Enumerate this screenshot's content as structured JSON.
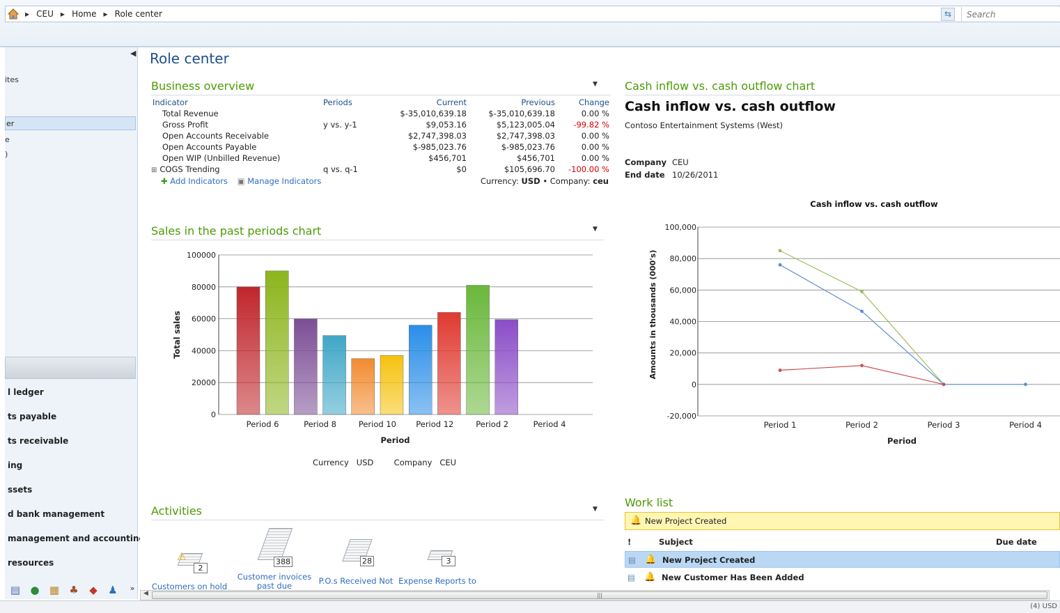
{
  "breadcrumb": [
    "CEU",
    "Home",
    "Role center"
  ],
  "search": {
    "placeholder": "Search"
  },
  "nav": {
    "fragments": [
      "ites",
      "er",
      "e",
      ")"
    ],
    "modules": [
      "l ledger",
      "ts payable",
      "ts receivable",
      "ing",
      "ssets",
      "d bank management",
      "management and accounting",
      "resources"
    ]
  },
  "page": {
    "title": "Role center"
  },
  "business_overview": {
    "title": "Business overview",
    "headers": {
      "indicator": "Indicator",
      "periods": "Periods",
      "current": "Current",
      "previous": "Previous",
      "change": "Change"
    },
    "rows": [
      {
        "indicator": "Total Revenue",
        "periods": "",
        "current": "$-35,010,639.18",
        "previous": "$-35,010,639.18",
        "change": "0.00 %",
        "neg": false
      },
      {
        "indicator": "Gross Profit",
        "periods": "y vs. y-1",
        "current": "$9,053.16",
        "previous": "$5,123,005.04",
        "change": "-99.82 %",
        "neg": true
      },
      {
        "indicator": "Open Accounts Receivable",
        "periods": "",
        "current": "$2,747,398.03",
        "previous": "$2,747,398.03",
        "change": "0.00 %",
        "neg": false
      },
      {
        "indicator": "Open Accounts Payable",
        "periods": "",
        "current": "$-985,023.76",
        "previous": "$-985,023.76",
        "change": "0.00 %",
        "neg": false
      },
      {
        "indicator": "Open WIP (Unbilled Revenue)",
        "periods": "",
        "current": "$456,701",
        "previous": "$456,701",
        "change": "0.00 %",
        "neg": false
      },
      {
        "indicator": "COGS Trending",
        "periods": "q vs. q-1",
        "current": "$0",
        "previous": "$105,696.70",
        "change": "-100.00 %",
        "neg": true
      }
    ],
    "add_label": "Add Indicators",
    "manage_label": "Manage Indicators",
    "currency_label": "Currency:",
    "currency_value": "USD",
    "company_label": "Company:",
    "company_value": "ceu"
  },
  "sales": {
    "title": "Sales in the past periods chart",
    "footer_currency_label": "Currency",
    "footer_currency_value": "USD",
    "footer_company_label": "Company",
    "footer_company_value": "CEU",
    "chart_data": {
      "type": "bar",
      "xlabel": "Period",
      "ylabel": "Total sales",
      "ylim": [
        0,
        100000
      ],
      "yticks": [
        0,
        20000,
        40000,
        60000,
        80000,
        100000
      ],
      "tick_labels": [
        "Period 6",
        "Period 8",
        "Period 10",
        "Period 12",
        "Period 2",
        "Period 4"
      ],
      "grid": true,
      "values": [
        80000,
        90000,
        60000,
        49500,
        35000,
        37000,
        56000,
        64000,
        81000,
        59500
      ],
      "colors": [
        "#c0262c",
        "#8db51d",
        "#7c4e95",
        "#3fa7c7",
        "#f28b30",
        "#f6c20e",
        "#2a8ee8",
        "#e03a30",
        "#6ab83b",
        "#8b4dc7"
      ]
    }
  },
  "cash": {
    "section_title": "Cash inflow vs. cash outflow chart",
    "heading": "Cash inflow vs. cash outflow",
    "subtitle": "Contoso Entertainment Systems (West)",
    "company_label": "Company",
    "company_value": "CEU",
    "enddate_label": "End date",
    "enddate_value": "10/26/2011",
    "chart_data": {
      "type": "line",
      "title": "Cash inflow vs. cash outflow",
      "xlabel": "Period",
      "ylabel": "Amounts in thousands (000's)",
      "categories": [
        "Period 1",
        "Period 2",
        "Period 3",
        "Period 4"
      ],
      "ylim": [
        -20000,
        100000
      ],
      "yticks": [
        -20000,
        0,
        20000,
        40000,
        60000,
        80000,
        100000
      ],
      "ytick_labels": [
        "-20,000",
        "0",
        "20,000",
        "40,000",
        "60,000",
        "80,000",
        "100,000"
      ],
      "grid": true,
      "series": [
        {
          "color": "#9dc05a",
          "values": [
            85000,
            59000,
            0,
            null
          ]
        },
        {
          "color": "#5b8fd0",
          "values": [
            76000,
            46500,
            0,
            0
          ]
        },
        {
          "color": "#d04e4e",
          "values": [
            9000,
            12000,
            0,
            null
          ]
        }
      ]
    }
  },
  "activities": {
    "title": "Activities",
    "items": [
      {
        "label": "Customers on hold",
        "count": "2"
      },
      {
        "label": "Customer invoices past due",
        "count": "388"
      },
      {
        "label": "P.O.s Received Not",
        "count": "28"
      },
      {
        "label": "Expense Reports to",
        "count": "3"
      }
    ]
  },
  "worklist": {
    "title": "Work list",
    "banner": "New Project Created",
    "col_flag": "!",
    "col_subject": "Subject",
    "col_due": "Due date",
    "rows": [
      {
        "subject": "New Project Created",
        "selected": true
      },
      {
        "subject": "New Customer Has Been Added",
        "selected": false
      }
    ]
  },
  "status": {
    "text": "(4)  USD"
  }
}
